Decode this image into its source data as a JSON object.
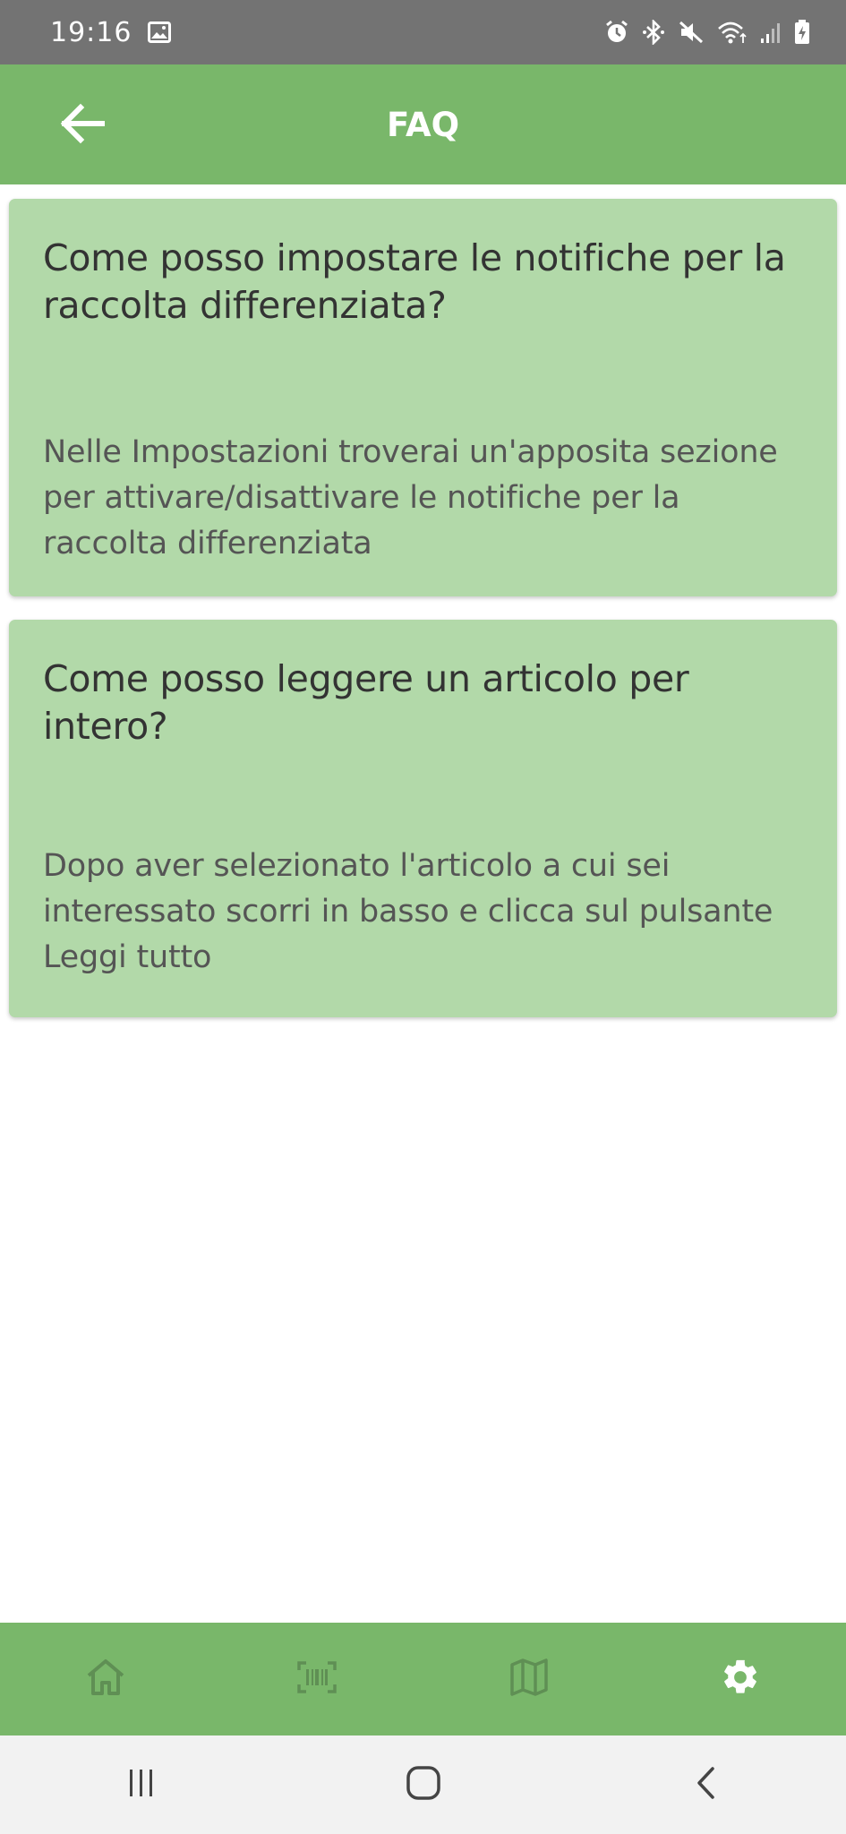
{
  "status_bar": {
    "time": "19:16",
    "icons": [
      "image-icon",
      "alarm-icon",
      "bluetooth-icon",
      "mute-icon",
      "wifi-icon",
      "signal-icon",
      "battery-charging-icon"
    ]
  },
  "app_bar": {
    "title": "FAQ",
    "back_icon": "arrow-left-icon"
  },
  "faqs": [
    {
      "question": "Come posso impostare le notifiche per la raccolta differenziata?",
      "answer": "Nelle Impostazioni troverai un'apposita sezione per attivare/disattivare le notifiche per la raccolta differenziata"
    },
    {
      "question": "Come posso leggere un articolo per intero?",
      "answer": "Dopo aver selezionato l'articolo a cui sei interessato scorri in basso e clicca sul pulsante Leggi tutto"
    }
  ],
  "bottom_nav": {
    "items": [
      {
        "icon": "home-icon",
        "active": false
      },
      {
        "icon": "barcode-scan-icon",
        "active": false
      },
      {
        "icon": "map-icon",
        "active": false
      },
      {
        "icon": "settings-gear-icon",
        "active": true
      }
    ],
    "active_color": "#ffffff",
    "inactive_color": "#5f8f54"
  },
  "system_nav": [
    "recents-icon",
    "home-circle-icon",
    "back-chevron-icon"
  ],
  "colors": {
    "primary": "#79b76a",
    "card": "#b2d9a9",
    "status_bar": "#737373"
  }
}
